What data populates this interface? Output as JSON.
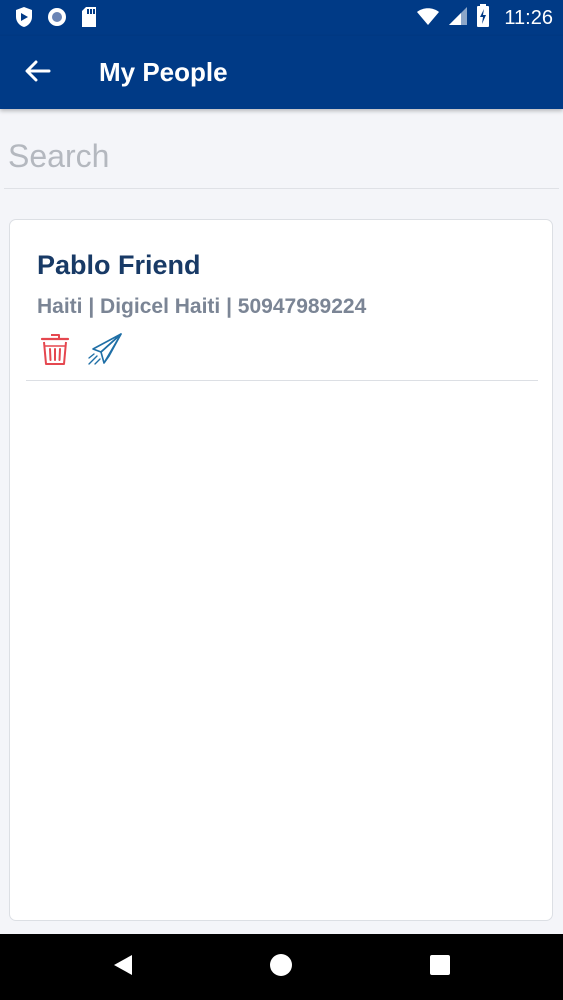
{
  "status_bar": {
    "time": "11:26",
    "left_icons": [
      "shield-notification-icon",
      "circle-notification-icon",
      "sd-card-icon"
    ],
    "right_icons": [
      "wifi-icon",
      "signal-icon",
      "battery-charging-icon"
    ]
  },
  "app_bar": {
    "title": "My People",
    "back_icon": "arrow-left-icon",
    "background_color": "#003a86"
  },
  "search": {
    "placeholder": "Search",
    "value": ""
  },
  "people": [
    {
      "name": "Pablo Friend",
      "details": "Haiti | Digicel Haiti | 50947989224",
      "actions": [
        {
          "icon": "trash-icon",
          "color": "#e5474f"
        },
        {
          "icon": "paper-plane-icon",
          "color": "#1f6fa6"
        }
      ]
    }
  ],
  "nav_bar": {
    "buttons": [
      "back-triangle-icon",
      "home-circle-icon",
      "recents-square-icon"
    ]
  }
}
